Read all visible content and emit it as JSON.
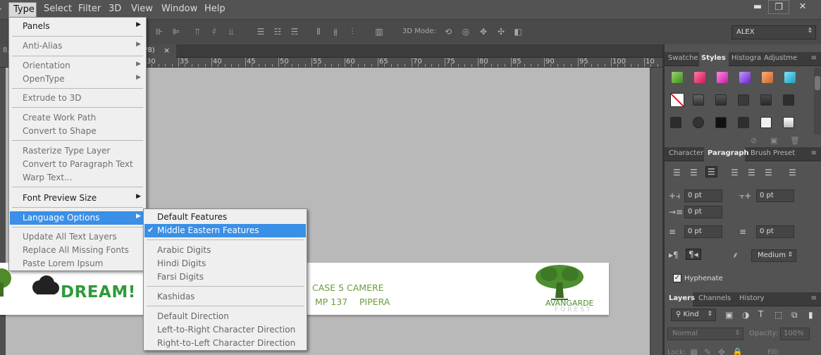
{
  "menubar": {
    "items": [
      "Type",
      "Select",
      "Filter",
      "3D",
      "View",
      "Window",
      "Help"
    ],
    "window_controls": {
      "minimize": "▬",
      "restore": "❐",
      "close": "✕"
    }
  },
  "options_bar": {
    "mode_label": "3D Mode:",
    "font_value": "ALEX"
  },
  "document": {
    "tab_suffix": "/8)",
    "tab_close": "×",
    "ruler_numbers": [
      "30",
      "35",
      "40",
      "45",
      "50",
      "55",
      "60",
      "65",
      "70",
      "75",
      "80",
      "85",
      "90",
      "95",
      "100",
      "10"
    ],
    "banner": {
      "logo_text": "DREAM!",
      "address_line1": "CASE 5 CAMERE",
      "address_line2a": "MP 137",
      "address_line2b": "PIPERA",
      "brand_name": "AVANGARDE",
      "brand_sub": "FOREST",
      "accent_color": "#6a9e3a"
    }
  },
  "type_menu": {
    "panels": "Panels",
    "anti_alias": "Anti-Alias",
    "orientation": "Orientation",
    "opentype": "OpenType",
    "extrude": "Extrude to 3D",
    "create_work_path": "Create Work Path",
    "convert_shape": "Convert to Shape",
    "rasterize": "Rasterize Type Layer",
    "convert_paragraph": "Convert to Paragraph Text",
    "warp": "Warp Text...",
    "font_preview": "Font Preview Size",
    "language_options": "Language Options",
    "update_all": "Update All Text Layers",
    "replace_fonts": "Replace All Missing Fonts",
    "paste_lorem": "Paste Lorem Ipsum",
    "highlight_color": "#3a8fe6"
  },
  "submenu": {
    "default_features": "Default Features",
    "middle_eastern": "Middle Eastern Features",
    "check": "✔",
    "arabic_digits": "Arabic Digits",
    "hindi_digits": "Hindi Digits",
    "farsi_digits": "Farsi Digits",
    "kashidas": "Kashidas",
    "default_direction": "Default Direction",
    "ltr": "Left-to-Right Character Direction",
    "rtl": "Right-to-Left Character Direction"
  },
  "styles_panel": {
    "tabs": [
      "Swatche",
      "Styles",
      "Histogra",
      "Adjustme"
    ]
  },
  "paragraph_panel": {
    "tabs": [
      "Character",
      "Paragraph",
      "Brush Preset"
    ],
    "indent_left": "0 pt",
    "indent_right": "0 pt",
    "indent_first": "0 pt",
    "space_before": "0 pt",
    "space_after": "0 pt",
    "justification": "Medium",
    "hyphenate_label": "Hyphenate"
  },
  "layers_panel": {
    "tabs": [
      "Layers",
      "Channels",
      "History"
    ],
    "kind": "Kind",
    "blend_mode": "Normal",
    "opacity_label": "Opacity:",
    "opacity_value": "100%",
    "lock_label": "Lock:",
    "fill_label": "Fill:"
  }
}
